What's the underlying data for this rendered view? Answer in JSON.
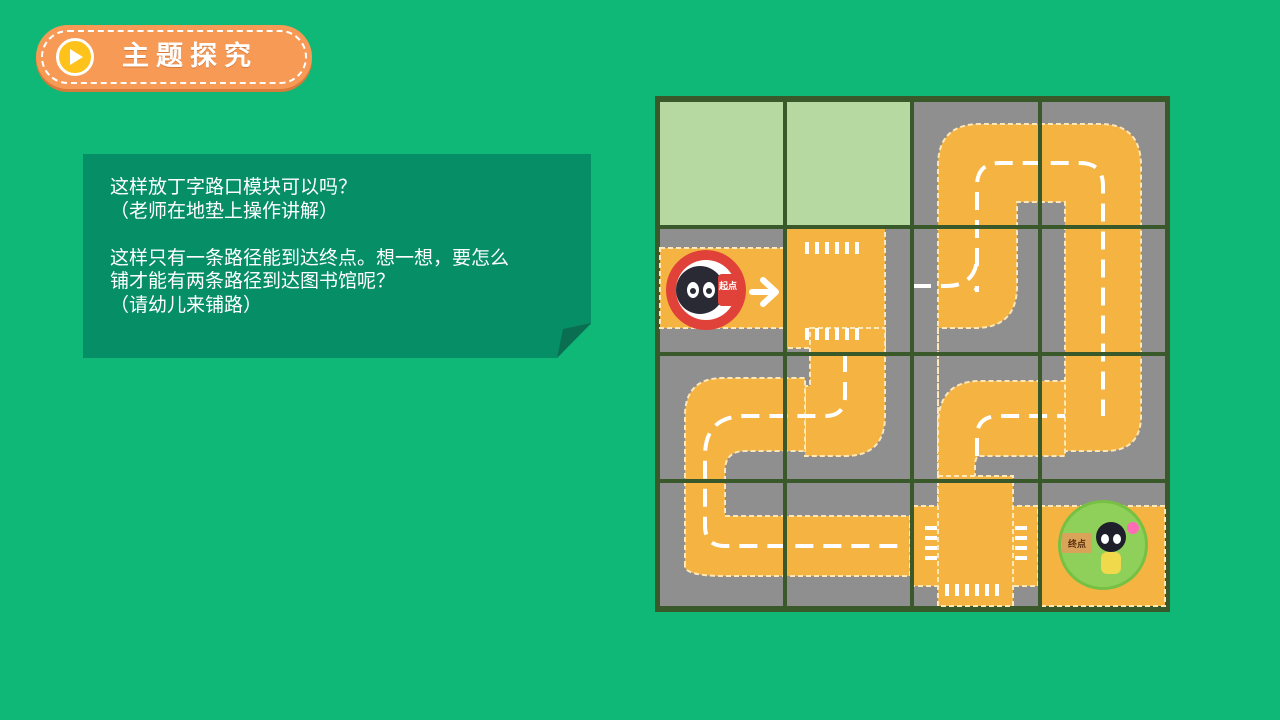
{
  "header": {
    "title": "主题探究",
    "play_icon": "play-icon"
  },
  "note": {
    "line1": "这样放丁字路口模块可以吗？",
    "line2": "（老师在地垫上操作讲解）",
    "line3": "这样只有一条路径能到达终点。想一想，要怎么",
    "line4": "铺才能有两条路径到达图书馆呢？",
    "line5": "（请幼儿来铺路）"
  },
  "board": {
    "start_label": "起点",
    "end_label": "终点"
  },
  "colors": {
    "background": "#0fb877",
    "badge": "#f79a55",
    "note": "#068f67",
    "road": "#f5b342",
    "ground": "#8f8f8f",
    "empty_tile": "#b6d9a2",
    "grid": "#39592b"
  }
}
